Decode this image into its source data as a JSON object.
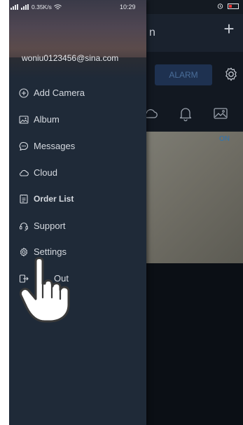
{
  "status_bar": {
    "network_speed": "0.35K/s",
    "time": "10:29"
  },
  "app": {
    "title_fragment": "n",
    "add_glyph": "+",
    "alarm_label": "ALARM",
    "video_status": "ON"
  },
  "drawer": {
    "email": "woniu0123456@sina.com",
    "items": [
      {
        "label": "Add Camera",
        "icon": "plus-circle-icon"
      },
      {
        "label": "Album",
        "icon": "image-icon"
      },
      {
        "label": "Messages",
        "icon": "chat-bubble-icon"
      },
      {
        "label": "Cloud",
        "icon": "cloud-icon"
      },
      {
        "label": "Order List",
        "icon": "list-icon"
      },
      {
        "label": "Support",
        "icon": "headset-icon"
      },
      {
        "label": "Settings",
        "icon": "gear-icon"
      },
      {
        "label": "Out",
        "icon": "logout-icon"
      }
    ]
  },
  "colors": {
    "drawer_bg": "#1f2a38",
    "accent_blue": "#2b75b5"
  }
}
